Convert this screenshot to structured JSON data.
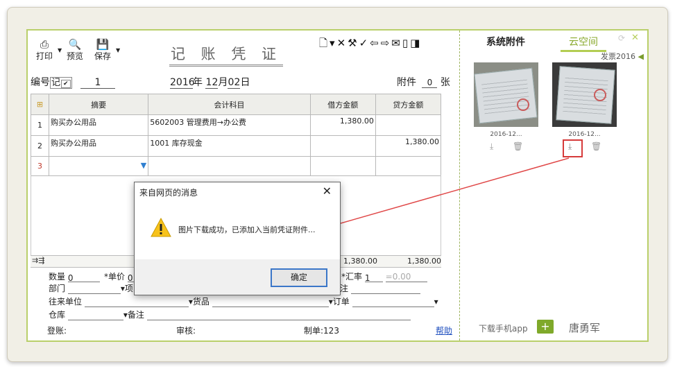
{
  "toolbar": {
    "print_label": "打印",
    "preview_label": "预览",
    "save_label": "保存",
    "right_tools": "🗋▾✕⚒✓⇦⇨✉▯◨"
  },
  "voucher": {
    "title": "记 账 凭 证",
    "number_label": "编号",
    "type_value": "记",
    "number_value": "1",
    "date_year": "2016",
    "date_year_label": "年",
    "date_month": "12",
    "date_month_label": "月",
    "date_day": "02",
    "date_day_label": "日",
    "attach_label": "附件",
    "attach_value": "0",
    "attach_unit": "张"
  },
  "table": {
    "headers": [
      "摘要",
      "会计科目",
      "借方金额",
      "贷方金额"
    ],
    "rows": [
      {
        "no": "1",
        "summary": "购买办公用品",
        "account": "5602003 管理费用→办公费",
        "debit": "1,380.00",
        "credit": ""
      },
      {
        "no": "2",
        "summary": "购买办公用品",
        "account": "1001 库存现金",
        "debit": "",
        "credit": "1,380.00"
      },
      {
        "no": "3",
        "summary": "",
        "account": "",
        "debit": "",
        "credit": ""
      }
    ],
    "total_debit": "1,380.00",
    "total_credit": "1,380.00"
  },
  "fields": {
    "qty_label": "数量",
    "qty_value": "0",
    "price_label": "*单价",
    "price_value": "0",
    "rate_label": "汇率",
    "rate_value": "1",
    "rate_result": "=0.00",
    "dept_label": "部门",
    "proj_label": "项",
    "note_short": "注",
    "contact_label": "往来单位",
    "goods_label": "货品",
    "order_label": "订单",
    "warehouse_label": "仓库",
    "remark_label": "备注"
  },
  "footer": {
    "posting_label": "登账:",
    "review_label": "审核:",
    "maker_label": "制单:123",
    "help_label": "帮助"
  },
  "attachments": {
    "tab_system": "系统附件",
    "tab_cloud": "云空间",
    "folder": "发票2016",
    "items": [
      {
        "caption": "2016-12..."
      },
      {
        "caption": "2016-12..."
      }
    ],
    "download_app": "下载手机app",
    "user": "唐勇军"
  },
  "dialog": {
    "title": "来自网页的消息",
    "message": "图片下载成功，已添加入当前凭证附件...",
    "ok_label": "确定"
  },
  "colors": {
    "accent_green": "#b3cd52",
    "highlight_red": "#d63a3a",
    "button_blue": "#3a76c8"
  }
}
